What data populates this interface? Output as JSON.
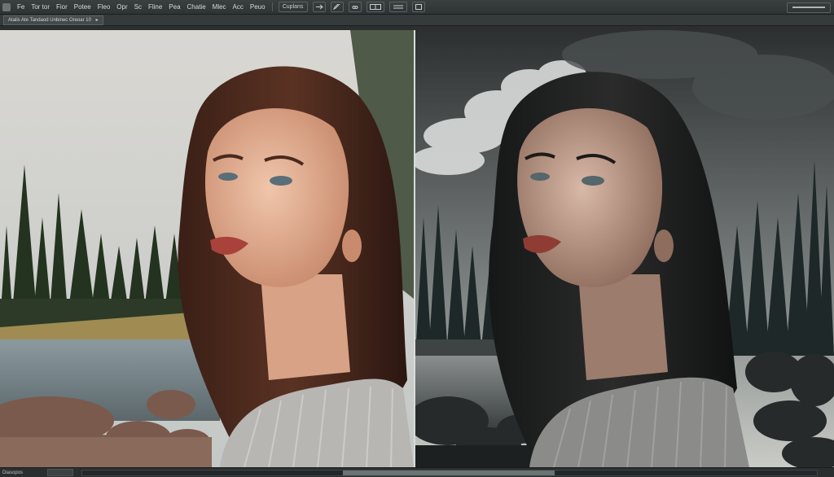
{
  "menu": {
    "items": [
      "Fe",
      "Tor tor",
      "Fior",
      "Potee",
      "Fleo",
      "Opr",
      "Sc",
      "Fline",
      "Pea",
      "Chatie",
      "Mlec",
      "Acc",
      "Peuo"
    ],
    "zoom_label": "Cuplans"
  },
  "options": {
    "doc_tab_label": "Atalis  Ate Tandaod Unbinec Oreoar 10",
    "close_glyph": "▸"
  },
  "statusbar": {
    "label": "Diasopos"
  },
  "canvas": {
    "left_image": "portrait-original-noisy",
    "right_image": "portrait-edited-dramatic"
  }
}
